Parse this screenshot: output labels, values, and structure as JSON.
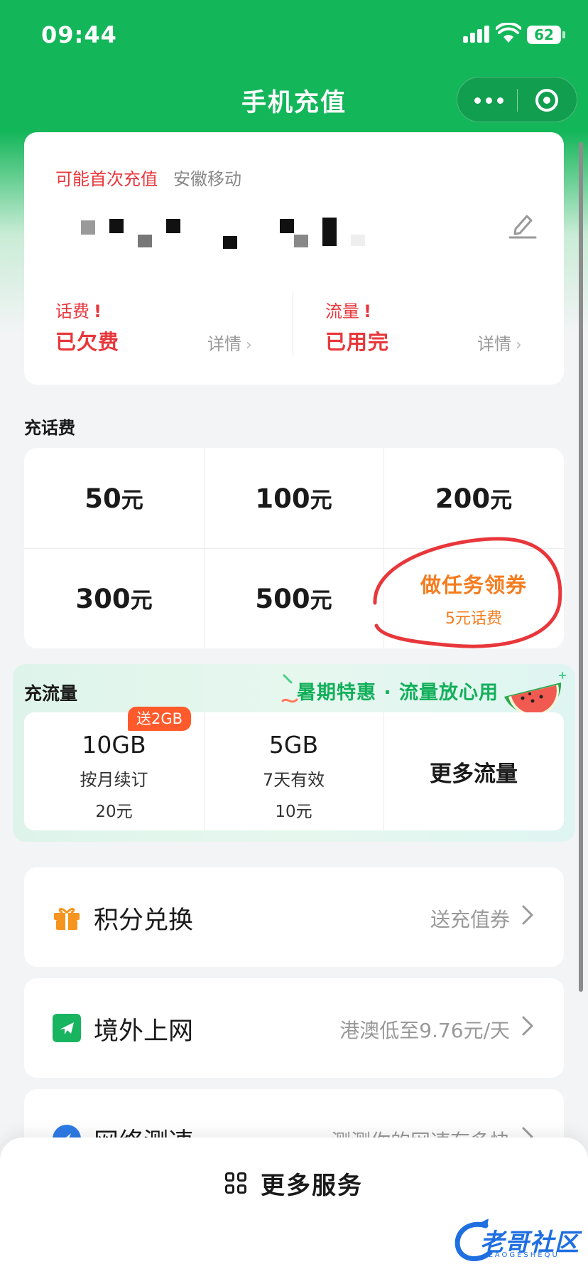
{
  "status_bar": {
    "time": "09:44",
    "battery": "62"
  },
  "nav": {
    "title": "手机充值"
  },
  "account": {
    "first_recharge": "可能首次充值",
    "carrier": "安徽移动",
    "balance": {
      "title": "话费",
      "alert": "!",
      "value": "已欠费",
      "detail": "详情"
    },
    "data_usage": {
      "title": "流量",
      "alert": "!",
      "value": "已用完",
      "detail": "详情"
    }
  },
  "bill": {
    "section_title": "充话费",
    "options": [
      {
        "amount": "50",
        "unit": "元"
      },
      {
        "amount": "100",
        "unit": "元"
      },
      {
        "amount": "200",
        "unit": "元"
      },
      {
        "amount": "300",
        "unit": "元"
      },
      {
        "amount": "500",
        "unit": "元"
      }
    ],
    "task": {
      "title": "做任务领券",
      "subtitle": "5元话费"
    }
  },
  "data": {
    "section_title": "充流量",
    "promo": "暑期特惠 · 流量放心用",
    "packages": [
      {
        "size": "10GB",
        "desc": "按月续订",
        "price": "20元",
        "badge": "送2GB"
      },
      {
        "size": "5GB",
        "desc": "7天有效",
        "price": "10元"
      }
    ],
    "more": "更多流量"
  },
  "list": [
    {
      "title": "积分兑换",
      "value": "送充值券",
      "icon": "gift-icon"
    },
    {
      "title": "境外上网",
      "value": "港澳低至9.76元/天",
      "icon": "plane-icon"
    },
    {
      "title": "网络测速",
      "value": "测测你的网速有多快",
      "icon": "speed-icon"
    }
  ],
  "bottom": {
    "more_services": "更多服务"
  },
  "watermark": {
    "text": "老哥社区",
    "sub": "LAOGESHEQU"
  },
  "colors": {
    "brand": "#14b65a",
    "alert": "#e8373b",
    "task": "#f57c1f",
    "badge": "#ff5a2b"
  }
}
